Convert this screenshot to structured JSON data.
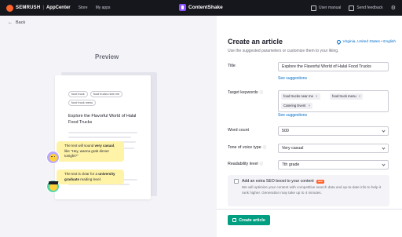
{
  "topbar": {
    "brand": "SEMRUSH",
    "brand_separator": "|",
    "brand_sub": "AppCenter",
    "nav": [
      "Store",
      "My apps"
    ],
    "app_name": "ContentShake",
    "user_manual": "User manual",
    "send_feedback": "Send feedback"
  },
  "back": {
    "label": "Back"
  },
  "preview": {
    "title": "Preview",
    "chips": [
      "food truck",
      "food trucks near me",
      "food truck menu"
    ],
    "article_title": "Explore the Flavorful World of Halal Food Trucks",
    "tips": {
      "tone_1": "The text will sound ",
      "tone_bold": "very casual",
      "tone_2": ", like \"Hey, wanna grab dinner tonight?\"",
      "read_1": "The text is clear for a ",
      "read_bold": "university graduate",
      "read_2": " reading level."
    }
  },
  "form": {
    "title": "Create an article",
    "locale": "Virginia, United States • English",
    "subtitle": "Use the suggested parameters or customize them to your liking.",
    "title_label": "Title",
    "title_value": "Explore the Flavorful World of Halal Food Trucks",
    "see_suggestions": "See suggestions",
    "keywords_label": "Target keywords",
    "keywords": [
      "food trucks near me",
      "food truck menu",
      "Catering Event"
    ],
    "word_count_label": "Word count",
    "word_count_value": "500",
    "tone_label": "Tone of voice type",
    "tone_value": "Very casual",
    "readability_label": "Readability level",
    "readability_value": "7th grade",
    "seo_title": "Add an extra SEO boost to your content",
    "seo_badge": "new",
    "seo_desc": "We will optimize your content with competitive search data and up-to-date info to help it rank higher. Generation may take up to 4 minutes.",
    "cta": "Create article"
  },
  "colors": {
    "accent_green": "#009f81",
    "link_blue": "#006dca",
    "brand_orange": "#ff642d",
    "tip_yellow": "#fff3a8"
  }
}
